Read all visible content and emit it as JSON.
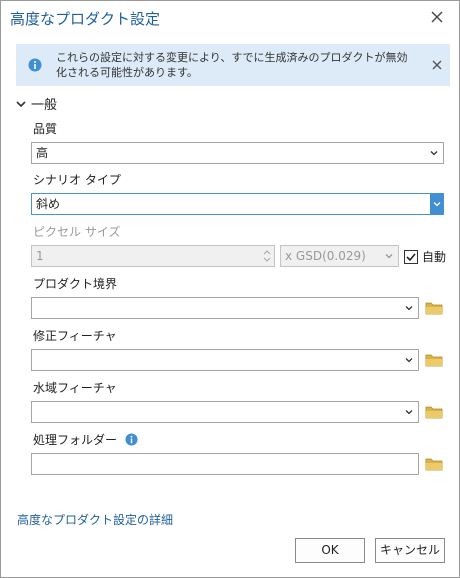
{
  "dialog": {
    "title": "高度なプロダクト設定"
  },
  "banner": {
    "text": "これらの設定に対する変更により、すでに生成済みのプロダクトが無効化される可能性があります。"
  },
  "section": {
    "title": "一般"
  },
  "fields": {
    "quality": {
      "label": "品質",
      "value": "高"
    },
    "scenario": {
      "label": "シナリオ タイプ",
      "value": "斜め"
    },
    "pixel_size": {
      "label": "ピクセル サイズ",
      "value": "1",
      "unit": "x GSD(0.029)",
      "auto_label": "自動",
      "auto_checked": true
    },
    "product_boundary": {
      "label": "プロダクト境界",
      "value": ""
    },
    "correction_features": {
      "label": "修正フィーチャ",
      "value": ""
    },
    "water_features": {
      "label": "水域フィーチャ",
      "value": ""
    },
    "processing_folder": {
      "label": "処理フォルダー",
      "value": ""
    }
  },
  "footer": {
    "link": "高度なプロダクト設定の詳細",
    "ok_label": "OK",
    "cancel_label": "キャンセル"
  },
  "colors": {
    "accent": "#1f5f9c",
    "banner_bg": "#dcebf7",
    "info_blue": "#3f8fd2",
    "folder": "#d8b34a"
  },
  "icons": [
    "close-icon",
    "info-icon",
    "chevron-down-icon",
    "folder-icon",
    "checkmark-icon"
  ]
}
